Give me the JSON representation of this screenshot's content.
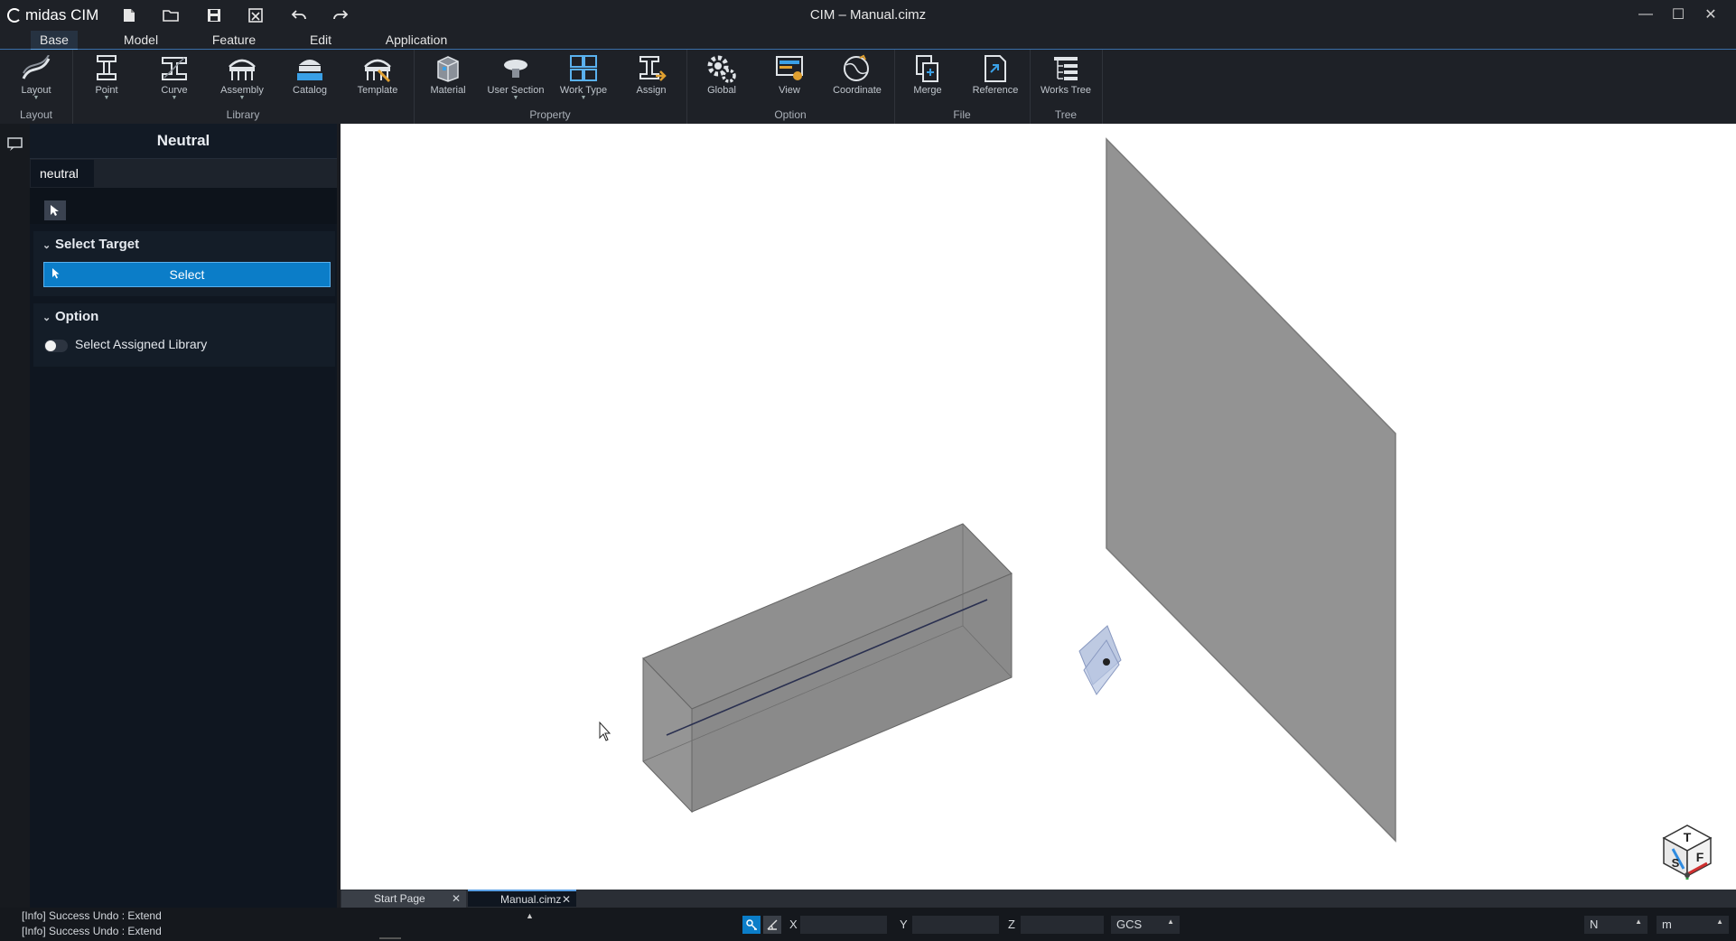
{
  "app": {
    "name": "midas CIM",
    "window_title": "CIM – Manual.cimz"
  },
  "quick_access": [
    "new-file-icon",
    "open-folder-icon",
    "save-icon",
    "close-file-icon",
    "undo-icon",
    "redo-icon"
  ],
  "window_controls": {
    "minimize": "—",
    "maximize": "☐",
    "close": "✕"
  },
  "menu_tabs": [
    {
      "label": "Base",
      "active": true
    },
    {
      "label": "Model",
      "active": false
    },
    {
      "label": "Feature",
      "active": false
    },
    {
      "label": "Edit",
      "active": false
    },
    {
      "label": "Application",
      "active": false
    }
  ],
  "ribbon": {
    "groups": [
      {
        "label": "Layout"
      },
      {
        "label": "Library"
      },
      {
        "label": "Property"
      },
      {
        "label": "Option"
      },
      {
        "label": "File"
      },
      {
        "label": "Tree"
      }
    ],
    "buttons": [
      {
        "label": "Layout",
        "icon": "layout-icon",
        "dropdown": true
      },
      {
        "label": "Point",
        "icon": "point-icon",
        "dropdown": true
      },
      {
        "label": "Curve",
        "icon": "curve-icon",
        "dropdown": true
      },
      {
        "label": "Assembly",
        "icon": "assembly-icon",
        "dropdown": true
      },
      {
        "label": "Catalog",
        "icon": "catalog-icon",
        "dropdown": false
      },
      {
        "label": "Template",
        "icon": "template-icon",
        "dropdown": false
      },
      {
        "label": "Material",
        "icon": "material-icon",
        "dropdown": false
      },
      {
        "label": "User Section",
        "icon": "user-section-icon",
        "dropdown": true
      },
      {
        "label": "Work Type",
        "icon": "work-type-icon",
        "dropdown": true
      },
      {
        "label": "Assign",
        "icon": "assign-icon",
        "dropdown": false
      },
      {
        "label": "Global",
        "icon": "global-icon",
        "dropdown": false
      },
      {
        "label": "View",
        "icon": "view-icon",
        "dropdown": false
      },
      {
        "label": "Coordinate",
        "icon": "coordinate-icon",
        "dropdown": false
      },
      {
        "label": "Merge",
        "icon": "merge-icon",
        "dropdown": false
      },
      {
        "label": "Reference",
        "icon": "reference-icon",
        "dropdown": false
      },
      {
        "label": "Works Tree",
        "icon": "works-tree-icon",
        "dropdown": false
      }
    ]
  },
  "panel": {
    "title": "Neutral",
    "tab": "neutral",
    "select_target": {
      "header": "Select Target",
      "button": "Select"
    },
    "option": {
      "header": "Option",
      "toggle_label": "Select Assigned Library",
      "toggle_on": false
    }
  },
  "doc_tabs": [
    {
      "label": "Start Page",
      "active": false
    },
    {
      "label": "Manual.cimz",
      "active": true
    }
  ],
  "status": {
    "log": [
      "[Info] Success Undo : Extend",
      "[Info] Success Undo : Extend"
    ],
    "coord_labels": {
      "x": "X",
      "y": "Y",
      "z": "Z"
    },
    "coord_system": "GCS",
    "force_unit": "N",
    "length_unit": "m"
  },
  "view_cube": {
    "top": "T",
    "left": "S",
    "front": "F"
  },
  "colors": {
    "accent": "#0b7dc8",
    "panel_bg": "#0f1620",
    "chrome_bg": "#1e2127",
    "viewport_bg": "#ffffff",
    "solid": "#8c8c8c"
  }
}
